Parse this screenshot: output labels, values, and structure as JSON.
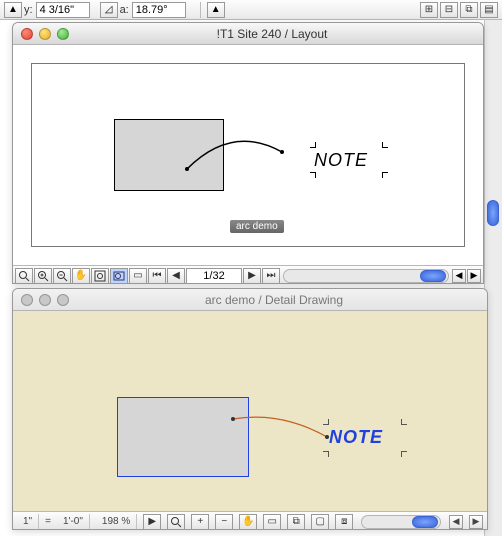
{
  "topbar": {
    "y_label": "y:",
    "y_value": "4 3/16\"",
    "a_label": "a:",
    "a_value": "18.79°"
  },
  "window1": {
    "title": "!T1 Site 240 / Layout",
    "note_text": "NOTE",
    "caption": "arc demo",
    "page_indicator": "1/32",
    "nav": {
      "first": "⏮",
      "prev": "◀",
      "next": "▶",
      "last": "⏭"
    }
  },
  "window2": {
    "title": "arc demo / Detail Drawing",
    "note_text": "NOTE",
    "status": {
      "unit_left": "1\"",
      "equals": "=",
      "unit_right": "1'-0\"",
      "zoom": "198 %"
    }
  },
  "icons": {
    "magnify_plus": "⊕",
    "magnify_minus": "⊖",
    "hand": "✋",
    "marquee": "▭"
  }
}
